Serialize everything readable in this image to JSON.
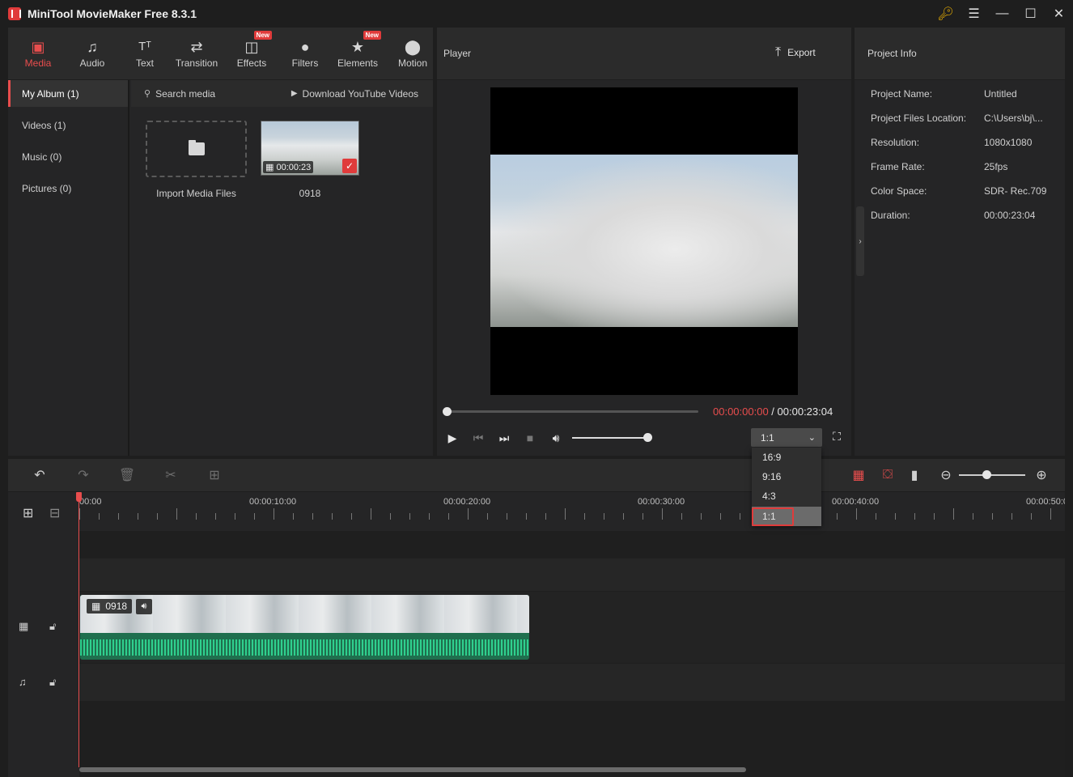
{
  "app": {
    "title": "MiniTool MovieMaker Free 8.3.1"
  },
  "toolbar": {
    "tabs": [
      {
        "label": "Media"
      },
      {
        "label": "Audio"
      },
      {
        "label": "Text"
      },
      {
        "label": "Transition"
      },
      {
        "label": "Effects",
        "badge": "New"
      },
      {
        "label": "Filters"
      },
      {
        "label": "Elements",
        "badge": "New"
      },
      {
        "label": "Motion"
      }
    ],
    "active": "Media",
    "accent_color": "#e84d4d"
  },
  "album": {
    "items": [
      {
        "label": "My Album (1)"
      },
      {
        "label": "Videos (1)"
      },
      {
        "label": "Music (0)"
      },
      {
        "label": "Pictures (0)"
      }
    ]
  },
  "media": {
    "search_label": "Search media",
    "youtube_label": "Download YouTube Videos",
    "import_label": "Import Media Files",
    "clip": {
      "name": "0918",
      "duration": "00:00:23"
    }
  },
  "player": {
    "title": "Player",
    "export_label": "Export",
    "time_current": "00:00:00:00",
    "time_separator": " / ",
    "time_total": "00:00:23:04",
    "progress": 0,
    "volume": 1,
    "aspect_ratio": "1:1",
    "aspect_options": [
      "16:9",
      "9:16",
      "4:3",
      "1:1"
    ]
  },
  "project_info": {
    "title": "Project Info",
    "rows": [
      {
        "key": "Project Name:",
        "value": "Untitled"
      },
      {
        "key": "Project Files Location:",
        "value": "C:\\Users\\bj\\..."
      },
      {
        "key": "Resolution:",
        "value": "1080x1080"
      },
      {
        "key": "Frame Rate:",
        "value": "25fps"
      },
      {
        "key": "Color Space:",
        "value": "SDR- Rec.709"
      },
      {
        "key": "Duration:",
        "value": "00:00:23:04"
      }
    ]
  },
  "timeline": {
    "ruler_labels": [
      "00:00",
      "00:00:10:00",
      "00:00:20:00",
      "00:00:30:00",
      "00:00:40:00",
      "00:00:50:00"
    ],
    "clip_name": "0918"
  }
}
